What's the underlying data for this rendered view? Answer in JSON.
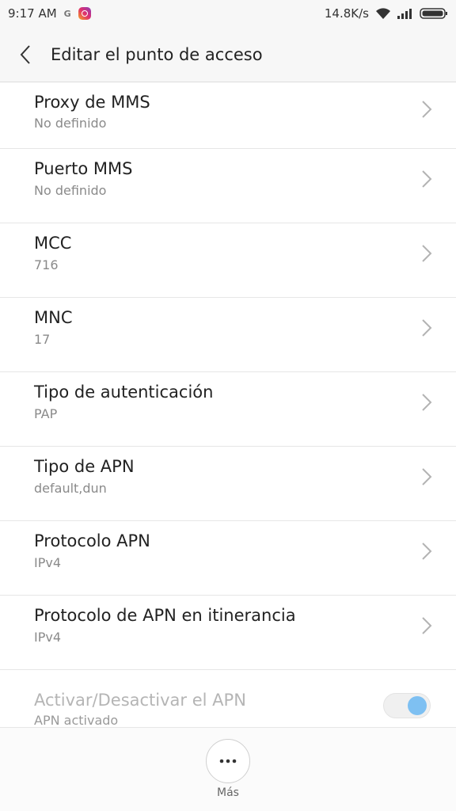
{
  "status": {
    "time": "9:17 AM",
    "g": "G",
    "speed": "14.8K/s"
  },
  "header": {
    "title": "Editar el punto de acceso"
  },
  "items": [
    {
      "title": "Proxy de MMS",
      "value": "No definido"
    },
    {
      "title": "Puerto MMS",
      "value": "No definido"
    },
    {
      "title": "MCC",
      "value": "716"
    },
    {
      "title": "MNC",
      "value": "17"
    },
    {
      "title": "Tipo de autenticación",
      "value": "PAP"
    },
    {
      "title": "Tipo de APN",
      "value": "default,dun"
    },
    {
      "title": "Protocolo APN",
      "value": "IPv4"
    },
    {
      "title": "Protocolo de APN en itinerancia",
      "value": "IPv4"
    }
  ],
  "apn_toggle": {
    "title": "Activar/Desactivar el APN",
    "value": "APN activado",
    "on": true,
    "accent": "#7ec0f2"
  },
  "bottom": {
    "more_label": "Más"
  }
}
